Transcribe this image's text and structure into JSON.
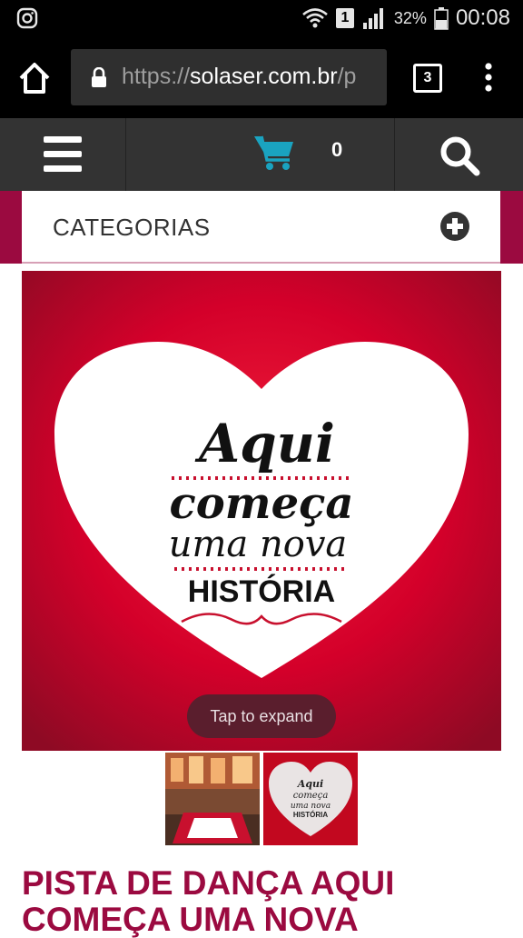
{
  "status_bar": {
    "sim_slot": "1",
    "battery": "32%",
    "time": "00:08",
    "icons": [
      "instagram-icon",
      "wifi-icon",
      "signal-icon",
      "battery-icon"
    ]
  },
  "browser": {
    "url_scheme": "https://",
    "url_domain": "solaser.com.br",
    "url_rest": "/p",
    "tab_count": "3"
  },
  "site_header": {
    "cart_count": "0",
    "cart_color": "#1aa3c0"
  },
  "categories": {
    "label": "CATEGORIAS"
  },
  "product_image": {
    "lines": [
      "Aqui",
      "começa",
      "uma nova",
      "HISTÓRIA"
    ],
    "tap_label": "Tap to expand"
  },
  "thumbnails": {
    "thumb2_lines": [
      "Aqui",
      "começa",
      "uma nova",
      "HISTÓRIA"
    ]
  },
  "product": {
    "title": "PISTA DE DANÇA AQUI COMEÇA UMA NOVA"
  },
  "colors": {
    "brand": "#9b0a40",
    "header_bg": "#333333",
    "image_red": "#d4002a"
  }
}
